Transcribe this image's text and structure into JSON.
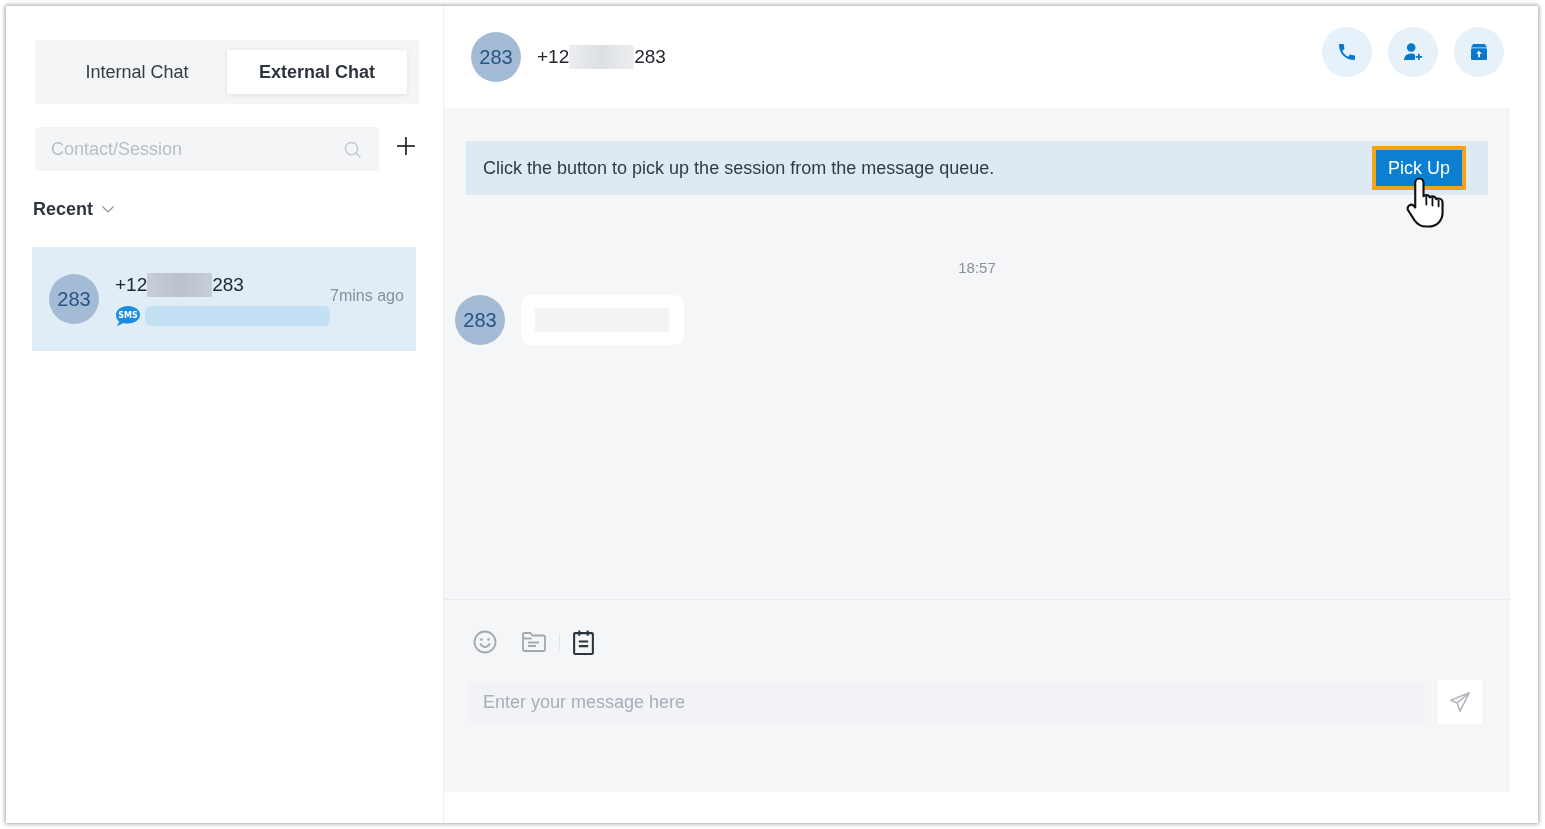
{
  "tabs": [
    {
      "label": "Internal Chat",
      "selected": false
    },
    {
      "label": "External Chat",
      "selected": true
    }
  ],
  "search": {
    "placeholder": "Contact/Session"
  },
  "list_header": {
    "label": "Recent"
  },
  "sessions": [
    {
      "avatar": "283",
      "number_start": "+12",
      "number_end": "283",
      "channel": "SMS",
      "time": "7mins ago",
      "selected": true
    }
  ],
  "conversation": {
    "avatar": "283",
    "number_start": "+12",
    "number_end": "283"
  },
  "banner": {
    "text": "Click the button to pick up the session from the message queue.",
    "button": "Pick Up",
    "highlighted": true
  },
  "messages": [
    {
      "time": "18:57",
      "avatar": "283"
    }
  ],
  "composer": {
    "placeholder": "Enter your message here"
  }
}
